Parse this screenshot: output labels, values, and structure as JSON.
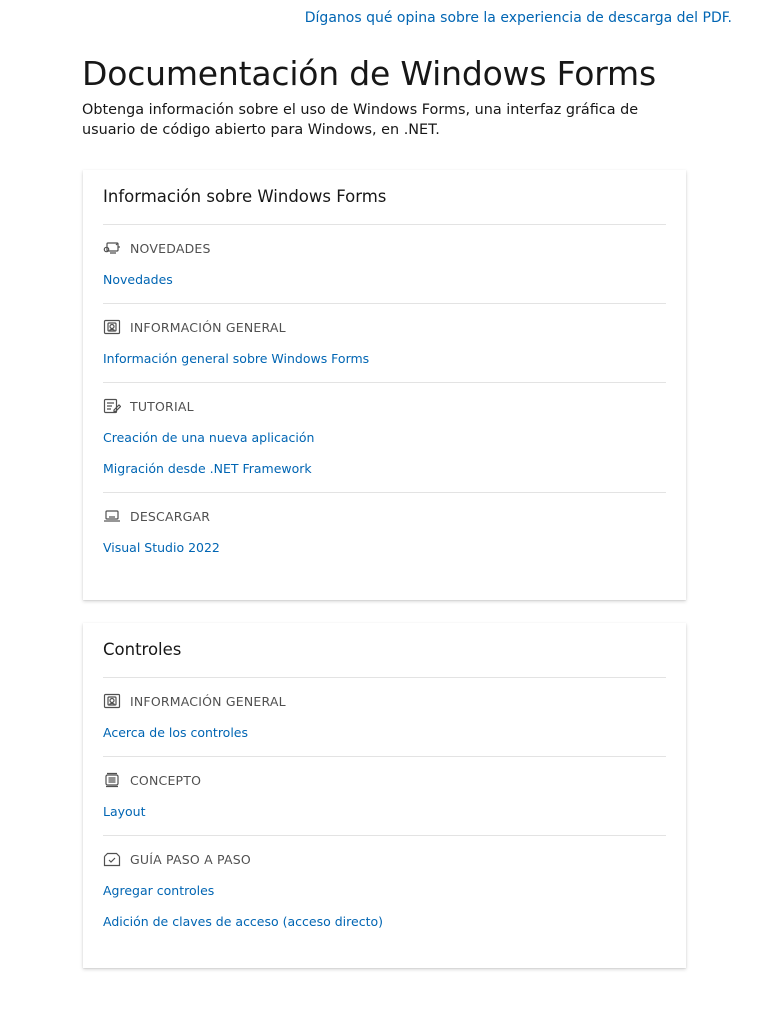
{
  "feedback_link": "Díganos qué opina sobre la experiencia de descarga del PDF.",
  "title": "Documentación de Windows Forms",
  "description": "Obtenga información sobre el uso de Windows Forms, una interfaz gráfica de usuario de código abierto para Windows, en .NET.",
  "cards": [
    {
      "title": "Información sobre Windows Forms",
      "sections": [
        {
          "icon": "whats-new-icon",
          "heading": "NOVEDADES",
          "links": [
            "Novedades"
          ]
        },
        {
          "icon": "overview-icon",
          "heading": "INFORMACIÓN GENERAL",
          "links": [
            "Información general sobre Windows Forms"
          ]
        },
        {
          "icon": "tutorial-icon",
          "heading": "TUTORIAL",
          "links": [
            "Creación de una nueva aplicación",
            "Migración desde .NET Framework"
          ]
        },
        {
          "icon": "download-icon",
          "heading": "DESCARGAR",
          "links": [
            "Visual Studio 2022"
          ]
        }
      ]
    },
    {
      "title": "Controles",
      "sections": [
        {
          "icon": "overview-icon",
          "heading": "INFORMACIÓN GENERAL",
          "links": [
            "Acerca de los controles"
          ]
        },
        {
          "icon": "concept-icon",
          "heading": "CONCEPTO",
          "links": [
            "Layout"
          ]
        },
        {
          "icon": "how-to-guide-icon",
          "heading": "GUÍA PASO A PASO",
          "links": [
            "Agregar controles",
            "Adición de claves de acceso (acceso directo)"
          ]
        }
      ]
    }
  ]
}
